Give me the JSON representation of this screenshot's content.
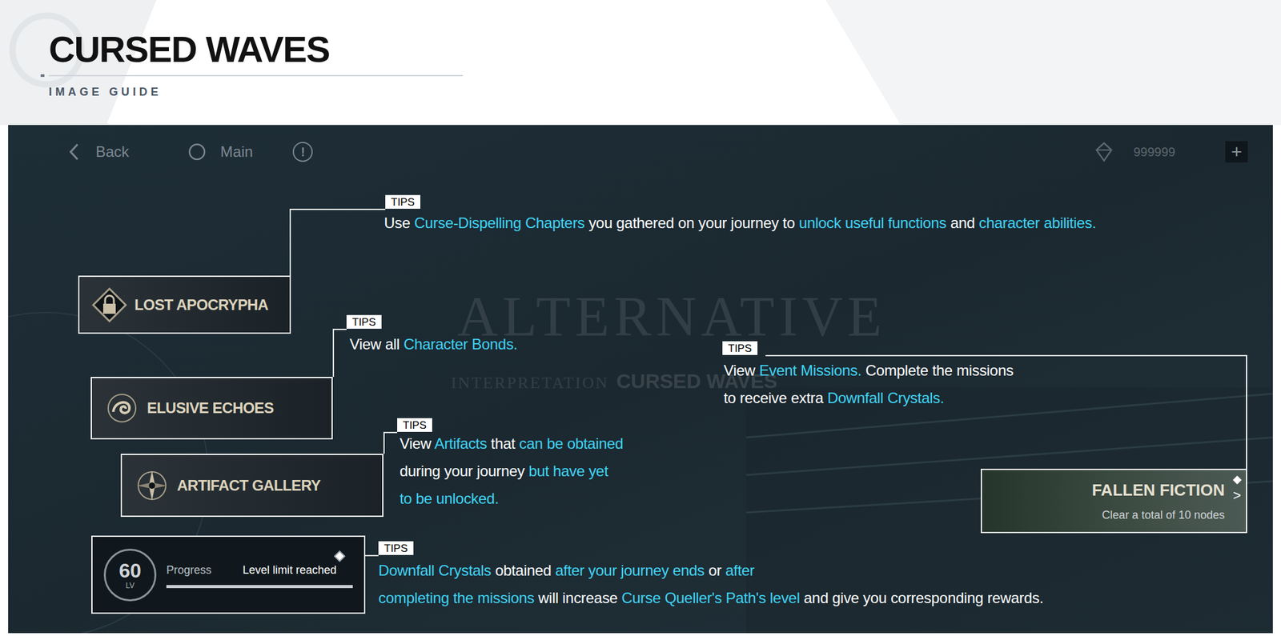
{
  "header": {
    "title": "CURSED WAVES",
    "subtitle": "IMAGE GUIDE"
  },
  "topbar": {
    "back": "Back",
    "main": "Main",
    "info": "!",
    "currency": "999999",
    "add": "+"
  },
  "watermark": {
    "title": "ALTERNATIVE",
    "subtitle": "INTERPRETATION",
    "brand": "CURSED WAVES"
  },
  "menu": [
    {
      "label": "LOST APOCRYPHA",
      "kind": "lock"
    },
    {
      "label": "ELUSIVE ECHOES",
      "kind": "swirl"
    },
    {
      "label": "ARTIFACT GALLERY",
      "kind": "compass"
    }
  ],
  "progress": {
    "lv": "60",
    "lv_unit": "LV",
    "label": "Progress",
    "status": "Level limit reached",
    "level": 1
  },
  "fallen": {
    "title": "FALLEN FICTION",
    "subtitle": "Clear a total of 10 nodes",
    "arrow": ">"
  },
  "tips": [
    {
      "badge": "TIPS",
      "lines": [
        [
          {
            "text": "Use ",
            "highlight": false
          },
          {
            "text": "Curse-Dispelling Chapters",
            "highlight": true
          },
          {
            "text": " you gathered on your journey to ",
            "highlight": false
          },
          {
            "text": "unlock useful functions",
            "highlight": true
          },
          {
            "text": " and ",
            "highlight": false
          },
          {
            "text": "character abilities.",
            "highlight": true
          }
        ]
      ]
    },
    {
      "badge": "TIPS",
      "lines": [
        [
          {
            "text": "View all ",
            "highlight": false
          },
          {
            "text": "Character Bonds.",
            "highlight": true
          }
        ]
      ]
    },
    {
      "badge": "TIPS",
      "lines": [
        [
          {
            "text": "View ",
            "highlight": false
          },
          {
            "text": "Artifacts",
            "highlight": true
          },
          {
            "text": " that ",
            "highlight": false
          },
          {
            "text": "can be obtained",
            "highlight": true
          }
        ],
        [
          {
            "text": "during your journey ",
            "highlight": false
          },
          {
            "text": "but have yet",
            "highlight": true
          }
        ],
        [
          {
            "text": "to be unlocked.",
            "highlight": true
          }
        ]
      ]
    },
    {
      "badge": "TIPS",
      "lines": [
        [
          {
            "text": "Downfall Crystals",
            "highlight": true
          },
          {
            "text": " obtained ",
            "highlight": false
          },
          {
            "text": "after your journey ends",
            "highlight": true
          },
          {
            "text": " or ",
            "highlight": false
          },
          {
            "text": "after",
            "highlight": true
          }
        ],
        [
          {
            "text": "completing the missions",
            "highlight": true
          },
          {
            "text": " will increase ",
            "highlight": false
          },
          {
            "text": "Curse Queller's Path's level",
            "highlight": true
          },
          {
            "text": " and give you corresponding rewards.",
            "highlight": false
          }
        ]
      ]
    },
    {
      "badge": "TIPS",
      "lines": [
        [
          {
            "text": "View ",
            "highlight": false
          },
          {
            "text": "Event Missions.",
            "highlight": true
          },
          {
            "text": " Complete the missions",
            "highlight": false
          }
        ],
        [
          {
            "text": "to receive extra ",
            "highlight": false
          },
          {
            "text": "Downfall Crystals.",
            "highlight": true
          }
        ]
      ]
    }
  ]
}
